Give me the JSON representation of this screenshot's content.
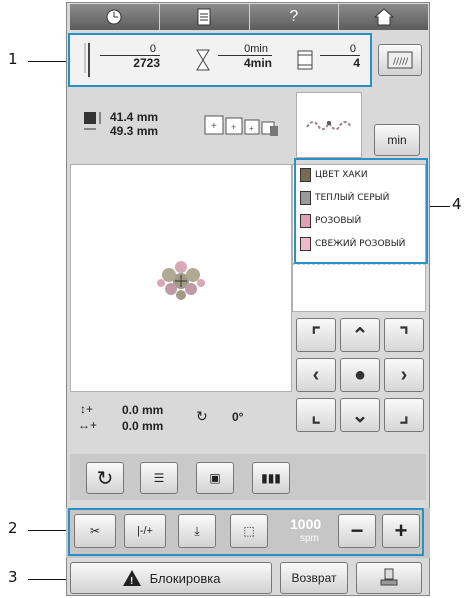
{
  "callouts": {
    "n1": "1",
    "n2": "2",
    "n3": "3",
    "n4": "4"
  },
  "topbar": {
    "icons": [
      "clock-icon",
      "document-icon",
      "help-icon",
      "home-icon"
    ],
    "help_glyph": "?"
  },
  "progress": {
    "stitches_done": "0",
    "stitches_total": "2723",
    "time_done": "0min",
    "time_total": "4min",
    "colors_done": "0",
    "colors_total": "4"
  },
  "size": {
    "height": "41.4 mm",
    "width": "49.3 mm"
  },
  "min_button": "min",
  "threads": [
    "ЦВЕТ ХАКИ",
    "ТЕПЛЫЙ СЕРЫЙ",
    "РОЗОВЫЙ",
    "СВЕЖИЙ РОЗОВЫЙ"
  ],
  "thread_colors": [
    "#7a6a52",
    "#9a9a9a",
    "#e0a0b4",
    "#f0b8c8"
  ],
  "offset": {
    "y": "0.0 mm",
    "x": "0.0 mm",
    "angle": "0°"
  },
  "speed": {
    "value": "1000",
    "unit": "spm"
  },
  "bottom": {
    "lock_label": "Блокировка",
    "return_label": "Возврат"
  }
}
